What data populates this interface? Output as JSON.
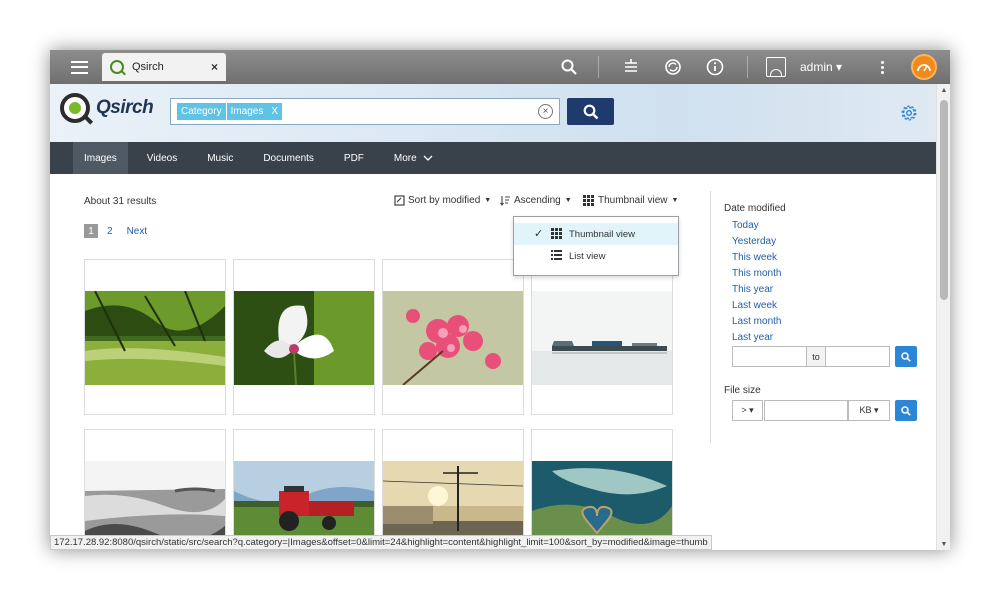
{
  "tab": {
    "title": "Qsirch",
    "close": "×"
  },
  "topbar": {
    "username": "admin ▾"
  },
  "brand": {
    "name": "Qsirch"
  },
  "search": {
    "chips": [
      "Category",
      "Images"
    ],
    "chip_remove": "X",
    "clear": "×"
  },
  "nav": {
    "items": [
      "Images",
      "Videos",
      "Music",
      "Documents",
      "PDF",
      "More"
    ],
    "active": "Images"
  },
  "results": {
    "count": "About 31 results"
  },
  "toolbar": {
    "sort": "Sort by modified",
    "order": "Ascending",
    "view": "Thumbnail view"
  },
  "view_menu": {
    "options": [
      "Thumbnail view",
      "List view"
    ],
    "selected": "Thumbnail view",
    "check": "✓"
  },
  "pager": {
    "current": "1",
    "pages": [
      "2"
    ],
    "next": "Next"
  },
  "thumbnails": [
    {
      "subject": "river-trees"
    },
    {
      "subject": "white-flower"
    },
    {
      "subject": "pink-blossom"
    },
    {
      "subject": "pier-boats"
    },
    {
      "subject": "rocky-shore"
    },
    {
      "subject": "red-tractor"
    },
    {
      "subject": "street-sunset"
    },
    {
      "subject": "heart-reef"
    }
  ],
  "sidebar": {
    "date_title": "Date modified",
    "date_options": [
      "Today",
      "Yesterday",
      "This week",
      "This month",
      "This year",
      "Last week",
      "Last month",
      "Last year"
    ],
    "range_to": "to",
    "size_title": "File size",
    "size_op": "> ▾",
    "size_unit": "KB ▾"
  },
  "status_url": "172.17.28.92:8080/qsirch/static/src/search?q.category=|Images&offset=0&limit=24&highlight=content&highlight_limit=100&sort_by=modified&image=thumb",
  "colors": {
    "nav_bg": "#39414a",
    "search_btn": "#1f3a6d",
    "chip": "#5fc3e5",
    "link": "#1f5fa8",
    "go_btn": "#2c86d6"
  }
}
